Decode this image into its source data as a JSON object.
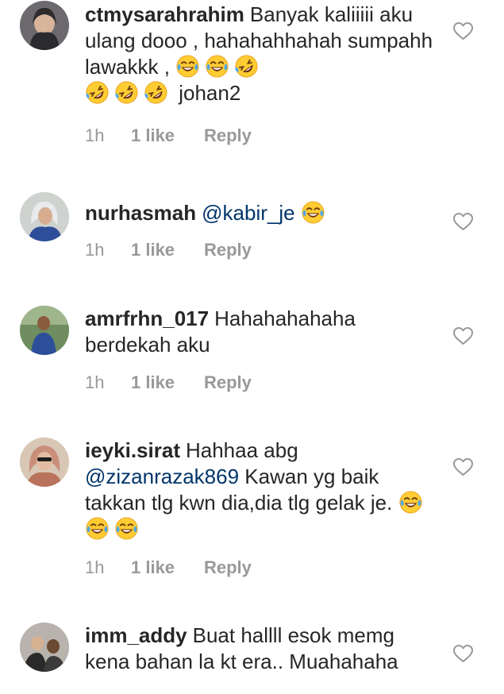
{
  "comments": [
    {
      "username": "ctmysarahrahim",
      "segments": [
        {
          "t": "Banyak kaliiiii aku ulang dooo , hahahahhahah sumpahh lawakkk , "
        },
        {
          "emoji": "joy"
        },
        {
          "emoji": "joy"
        },
        {
          "emoji": "rofl"
        },
        {
          "br": true
        },
        {
          "emoji": "rofl"
        },
        {
          "emoji": "rofl"
        },
        {
          "emoji": "rofl"
        },
        {
          "t": " johan2"
        }
      ],
      "time": "1h",
      "likes": "1 like",
      "reply": "Reply"
    },
    {
      "username": "nurhasmah",
      "segments": [
        {
          "mention": "@kabir_je"
        },
        {
          "t": " "
        },
        {
          "emoji": "joy"
        }
      ],
      "time": "1h",
      "likes": "1 like",
      "reply": "Reply"
    },
    {
      "username": "amrfrhn_017",
      "segments": [
        {
          "t": "Hahahahahaha berdekah aku"
        }
      ],
      "time": "1h",
      "likes": "1 like",
      "reply": "Reply"
    },
    {
      "username": "ieyki.sirat",
      "segments": [
        {
          "t": "Hahhaa abg "
        },
        {
          "mention": "@zizanrazak869"
        },
        {
          "t": " Kawan yg baik takkan tlg kwn dia,dia tlg gelak je. "
        },
        {
          "emoji": "joy"
        },
        {
          "emoji": "joy"
        },
        {
          "emoji": "joy"
        }
      ],
      "time": "1h",
      "likes": "1 like",
      "reply": "Reply"
    },
    {
      "username": "imm_addy",
      "segments": [
        {
          "t": "Buat hallll esok memg kena bahan la kt era.. Muahahaha"
        }
      ],
      "time": "",
      "likes": "",
      "reply": ""
    }
  ],
  "icons": {
    "like": "heart-outline-icon",
    "joy": "face-with-tears-of-joy-emoji",
    "rofl": "rolling-on-the-floor-laughing-emoji"
  },
  "colors": {
    "text": "#262626",
    "mention": "#003569",
    "meta": "#999999",
    "heart_stroke": "#999999"
  }
}
